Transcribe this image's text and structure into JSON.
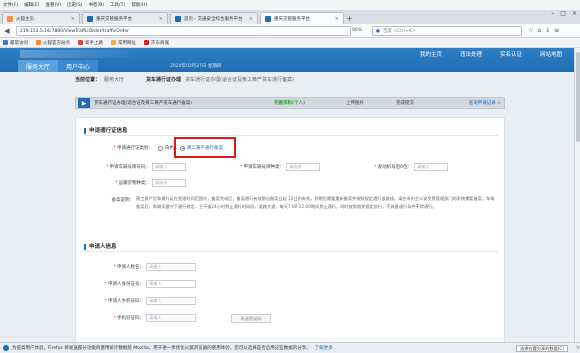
{
  "browser": {
    "menu": [
      "文件(F)",
      "编辑(E)",
      "查看(V)",
      "历史(S)",
      "书签(B)",
      "工具(T)",
      "帮助(H)"
    ],
    "tabs": [
      {
        "label": "火狐主页",
        "color": "#ff8a3d",
        "active": false
      },
      {
        "label": "重庆交管服务平台",
        "color": "#1f6db3",
        "active": false
      },
      {
        "label": "首页 - 交通安全综合服务平台",
        "color": "#1f6db3",
        "active": false
      },
      {
        "label": "重庆交管服务平台",
        "color": "#1f6db3",
        "active": true
      }
    ],
    "url": "219.153.5.16:7880/ViewTrafficOrder/trafficOrder",
    "zoom": "90%",
    "search_placeholder": "百度 <Ctrl+K>",
    "bookmarks": [
      {
        "label": "最常访问",
        "color": "#3a7bd5"
      },
      {
        "label": "火狐官方站点",
        "color": "#ff8a3d"
      },
      {
        "label": "新手上路",
        "color": "#e0453a"
      },
      {
        "label": "常用网址",
        "color": "#f2b230"
      },
      {
        "label": "京东商城",
        "color": "#d4232b"
      }
    ]
  },
  "site": {
    "toplinks": [
      "我的主页",
      "违法处理",
      "实名认证",
      "网站地图"
    ],
    "nav_tabs": [
      "服务大厅",
      "用户中心"
    ],
    "date": "2020年02月27日 星期四"
  },
  "breadcrumb": {
    "current_label": "当前位置：",
    "hall": "服务大厅",
    "section": "货车通行证办理",
    "sub": "货车通行证办理(适合证及黄工黄产货车通行备案)"
  },
  "steps": {
    "items": [
      "货车通行证办理(适合证及黄工黄产货车通行备案)",
      "完善资料(个人)",
      "上传图片",
      "完成提交"
    ],
    "query_link": "查询申请记录 >"
  },
  "form": {
    "section1_title": "申请通行证信息",
    "type_label": "申请通行证类别：",
    "type_options": [
      "白色",
      "黄工黄产通行备案"
    ],
    "type_selected": 1,
    "plate_type_label": "申请车辆号牌号码：",
    "plate_type_placeholder": "请输入",
    "plate_kind_label": "申请车辆号牌种类：",
    "plate_kind_placeholder": "请选择",
    "engine_label": "发动机号后6位：",
    "engine_placeholder": "请输入",
    "vehicle_kind_label": "运输货物种类：",
    "vehicle_kind_placeholder": "请选择",
    "note_label": "备案说明：",
    "note_text": "黄工黄产货车通行证在受理时间范围内，备案完成后，备案通行有效期自备案日起 15日内有效，到期后需要重新备案并按照规定通行该路线。请在市内主公安交警管理部门的系统需要备案。车辆备案后，车辆须遵守下通行规定，主干道24小时禁止通行时间段，道路大道，每天7:00-22:00期间禁止通行，同时按照相关规定执行，不具备通行条件不得通行。",
    "section2_title": "申请人信息",
    "applicant_name_label": "申请人姓名：",
    "applicant_name_placeholder": "请输入",
    "applicant_id_label": "申请人身份证号：",
    "applicant_id_placeholder": "请输入",
    "applicant_phone_label": "申请人手机号码：",
    "applicant_phone_placeholder": "请输入",
    "sms_label": "手机验证码：",
    "sms_placeholder": "请输入",
    "sms_button": "发送验证码"
  },
  "statusbar": {
    "message": "为提高用户体验，Firefox 将发送部分功能的使用统计数据给 Mozilla，用于进一步优化火狐浏览器的使用体验。您可以选择是否启用这些数据的分享。",
    "link": "了解更多",
    "button": "选择在要分享的数据(C)"
  }
}
